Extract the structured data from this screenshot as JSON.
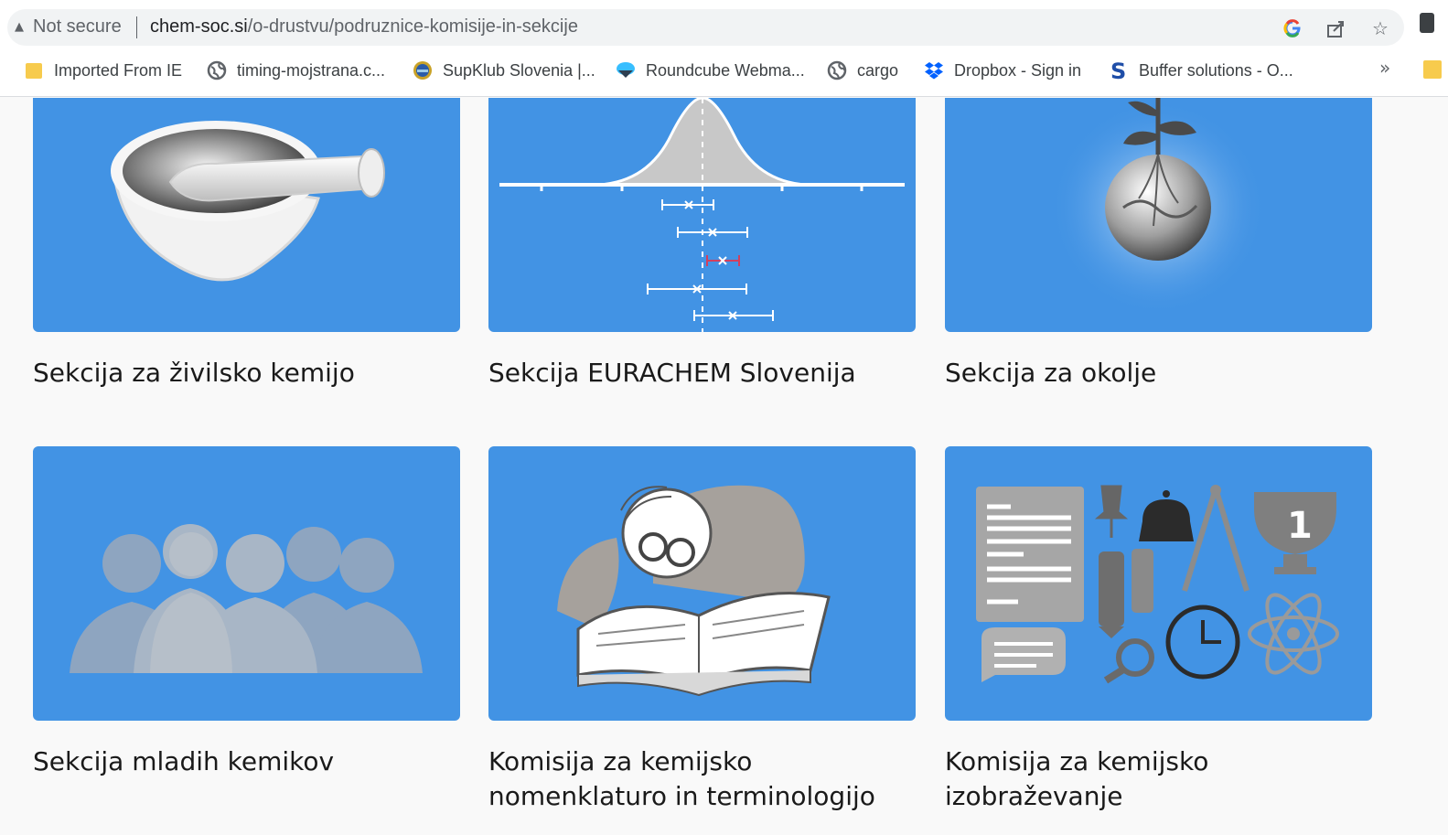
{
  "browser": {
    "security_text": "Not secure",
    "url_host": "chem-soc.si",
    "url_path": "/o-drustvu/podruznice-komisije-in-sekcije",
    "icons": [
      "google-icon",
      "share-icon",
      "star-icon",
      "extensions-icon"
    ]
  },
  "bookmarks": [
    {
      "label": "Imported From IE",
      "icon": "folder-icon"
    },
    {
      "label": "timing-mojstrana.c...",
      "icon": "globe-icon"
    },
    {
      "label": "SupKlub Slovenia |...",
      "icon": "supklub-icon"
    },
    {
      "label": "Roundcube Webma...",
      "icon": "roundcube-icon"
    },
    {
      "label": "cargo",
      "icon": "globe-icon"
    },
    {
      "label": "Dropbox - Sign in",
      "icon": "dropbox-icon"
    },
    {
      "label": "Buffer solutions - O...",
      "icon": "buffer-icon"
    }
  ],
  "bookmarks_overflow": "»",
  "cards": [
    {
      "title": "Sekcija za živilsko kemijo",
      "image": "mortar-pestle-illustration"
    },
    {
      "title": "Sekcija EURACHEM Slovenija",
      "image": "distribution-error-bars-illustration"
    },
    {
      "title": "Sekcija za okolje",
      "image": "globe-plant-illustration"
    },
    {
      "title": "Sekcija mladih kemikov",
      "image": "people-silhouettes-illustration"
    },
    {
      "title": "Komisija za kemijsko nomenklaturo in terminologijo",
      "image": "scholar-reading-book-illustration"
    },
    {
      "title": "Komisija za kemijsko izobraževanje",
      "image": "education-icons-illustration"
    }
  ],
  "colors": {
    "card_bg": "#4293e4",
    "page_bg": "#f9f9f9",
    "title": "#1a1a1a"
  }
}
